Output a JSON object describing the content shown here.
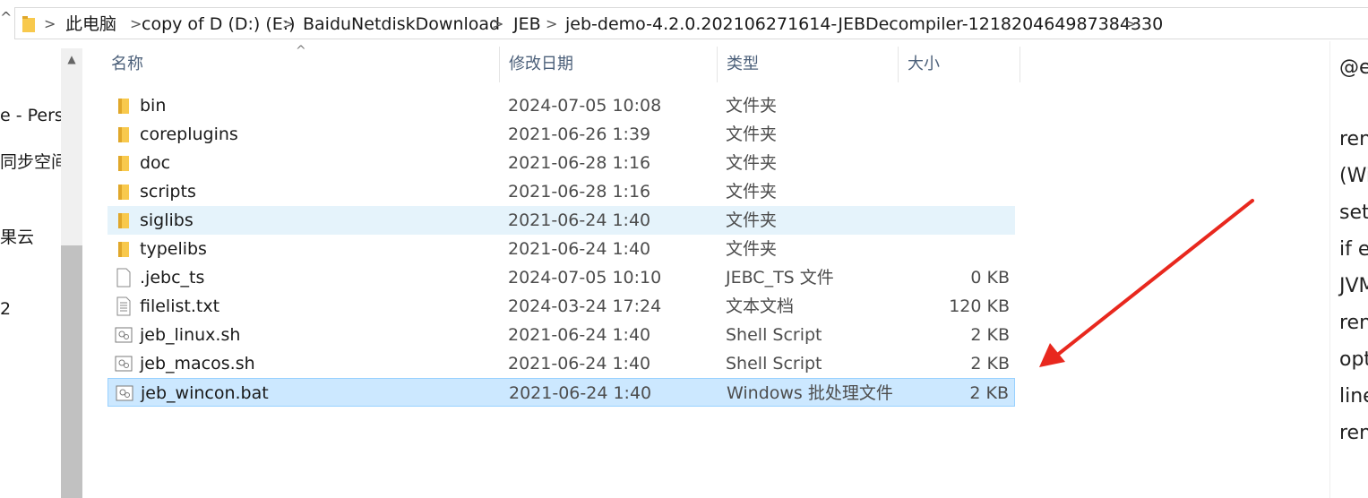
{
  "address": {
    "crumbs": [
      "此电脑",
      "copy of D (D:) (E:)",
      "BaiduNetdiskDownload",
      "JEB",
      "jeb-demo-4.2.0.202106271614-JEBDecompiler-121820464987384330"
    ]
  },
  "nav": {
    "items": [
      "e - Perso",
      "同步空间",
      "果云",
      "2"
    ]
  },
  "columns": {
    "name": "名称",
    "date": "修改日期",
    "type": "类型",
    "size": "大小"
  },
  "files": [
    {
      "name": "bin",
      "date": "2024-07-05 10:08",
      "type": "文件夹",
      "size": "",
      "icon": "folder-icon"
    },
    {
      "name": "coreplugins",
      "date": "2021-06-26 1:39",
      "type": "文件夹",
      "size": "",
      "icon": "folder-icon"
    },
    {
      "name": "doc",
      "date": "2021-06-28 1:16",
      "type": "文件夹",
      "size": "",
      "icon": "folder-icon"
    },
    {
      "name": "scripts",
      "date": "2021-06-28 1:16",
      "type": "文件夹",
      "size": "",
      "icon": "folder-icon"
    },
    {
      "name": "siglibs",
      "date": "2021-06-24 1:40",
      "type": "文件夹",
      "size": "",
      "icon": "folder-icon"
    },
    {
      "name": "typelibs",
      "date": "2021-06-24 1:40",
      "type": "文件夹",
      "size": "",
      "icon": "folder-icon"
    },
    {
      "name": ".jebc_ts",
      "date": "2024-07-05 10:10",
      "type": "JEBC_TS 文件",
      "size": "0 KB",
      "icon": "blank-file-icon"
    },
    {
      "name": "filelist.txt",
      "date": "2024-03-24 17:24",
      "type": "文本文档",
      "size": "120 KB",
      "icon": "text-file-icon"
    },
    {
      "name": "jeb_linux.sh",
      "date": "2021-06-24 1:40",
      "type": "Shell Script",
      "size": "2 KB",
      "icon": "script-file-icon"
    },
    {
      "name": "jeb_macos.sh",
      "date": "2021-06-24 1:40",
      "type": "Shell Script",
      "size": "2 KB",
      "icon": "script-file-icon"
    },
    {
      "name": "jeb_wincon.bat",
      "date": "2021-06-24 1:40",
      "type": "Windows 批处理文件",
      "size": "2 KB",
      "icon": "script-file-icon"
    }
  ],
  "hovered_row": 4,
  "selected_row": 10,
  "preview": {
    "lines": [
      "@e",
      "ren",
      "(Wi",
      "set",
      "if e",
      "JVM",
      "ren",
      "opt",
      "line",
      "ren"
    ]
  },
  "colors": {
    "selected": "#cce8ff",
    "hover": "#e5f3fb",
    "arrow": "#e8281e",
    "folder": "#f8c94d"
  }
}
